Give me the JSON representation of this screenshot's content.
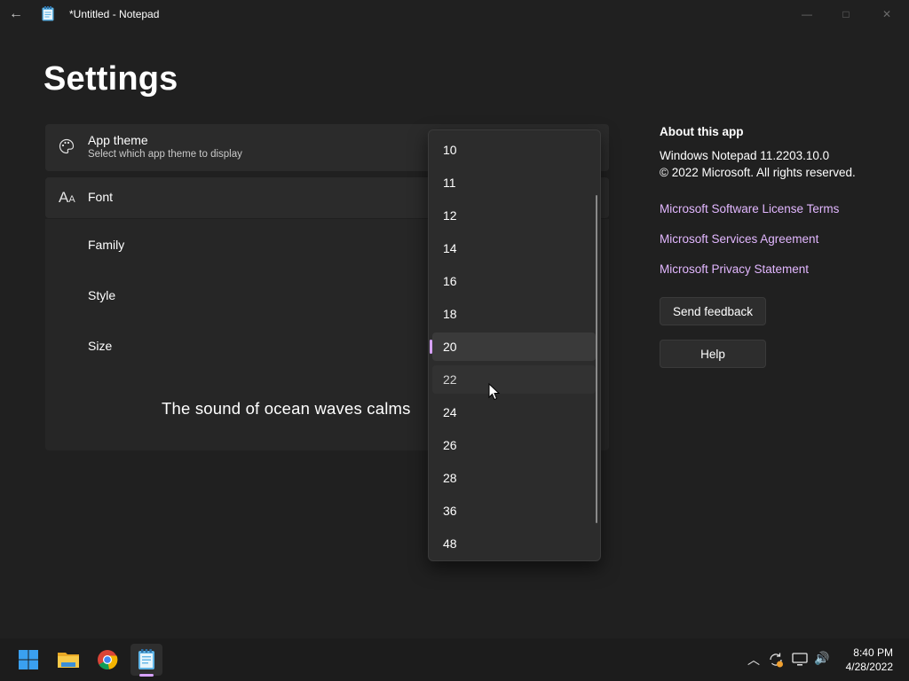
{
  "window": {
    "title": "*Untitled - Notepad",
    "icons": {
      "back": "back-arrow-icon",
      "app": "notepad-icon",
      "minimize": "minimize-icon",
      "maximize": "maximize-icon",
      "close": "close-icon"
    },
    "glyphs": {
      "back": "←",
      "minimize": "—",
      "maximize": "□",
      "close": "✕"
    }
  },
  "page_title": "Settings",
  "app_theme": {
    "title": "App theme",
    "subtitle": "Select which app theme to display",
    "icon": "palette-icon"
  },
  "font": {
    "title": "Font",
    "icon": "font-icon",
    "icon_glyph": "A",
    "rows": {
      "family": "Family",
      "style": "Style",
      "size": "Size"
    },
    "preview_text": "The sound of ocean waves calms"
  },
  "size_dropdown": {
    "options": [
      "10",
      "11",
      "12",
      "14",
      "16",
      "18",
      "20",
      "22",
      "24",
      "26",
      "28",
      "36",
      "48"
    ],
    "selected": "20",
    "hovered": "22"
  },
  "about": {
    "heading": "About this app",
    "version": "Windows Notepad 11.2203.10.0",
    "copyright": "© 2022 Microsoft. All rights reserved.",
    "links": [
      "Microsoft Software License Terms",
      "Microsoft Services Agreement",
      "Microsoft Privacy Statement"
    ],
    "send_feedback": "Send feedback",
    "help": "Help"
  },
  "taskbar": {
    "apps": [
      "windows-start-icon",
      "file-explorer-icon",
      "chrome-icon",
      "notepad-icon"
    ],
    "tray_icons": [
      "chevron-up-icon",
      "sync-icon",
      "network-icon",
      "volume-icon"
    ],
    "tray_glyphs": {
      "chevron": "︿",
      "volume": "🔊"
    },
    "time": "8:40 PM",
    "date": "4/28/2022"
  },
  "colors": {
    "background": "#202020",
    "card": "#2b2b2b",
    "accent": "#d7a1ff",
    "link": "#e2b7ff",
    "text": "#ffffff"
  }
}
